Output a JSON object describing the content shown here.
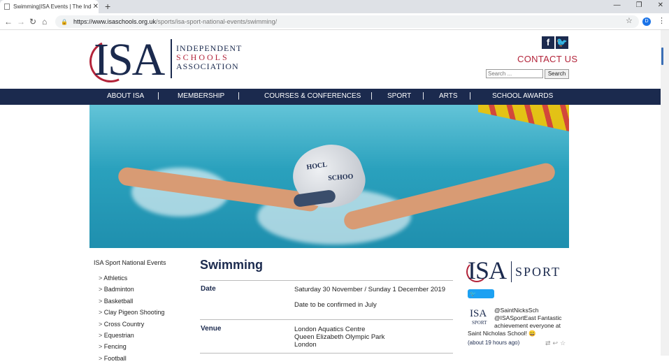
{
  "browser": {
    "tab_title": "Swimming|ISA Events | The Indep",
    "new_tab": "+",
    "url_host": "https://www.isaschools.org.uk",
    "url_path": "/sports/isa-sport-national-events/swimming/",
    "profile_initial": "D"
  },
  "header": {
    "logo_letters": "ISA",
    "logo_line1": "INDEPENDENT",
    "logo_line2": "SCHOOLS",
    "logo_line3": "ASSOCIATION",
    "facebook_glyph": "f",
    "twitter_glyph": "t",
    "contact": "CONTACT US",
    "search_placeholder": "Search ...",
    "search_button": "Search"
  },
  "nav": {
    "items": [
      "ABOUT ISA",
      "MEMBERSHIP",
      "COURSES & CONFERENCES",
      "SPORT",
      "ARTS",
      "SCHOOL AWARDS"
    ],
    "separator": "|"
  },
  "hero": {
    "cap_line1": "HOCL",
    "cap_line2": "SCHOO"
  },
  "sidebar": {
    "title": "ISA Sport National Events",
    "items": [
      "Athletics",
      "Badminton",
      "Basketball",
      "Clay Pigeon Shooting",
      "Cross Country",
      "Equestrian",
      "Fencing",
      "Football"
    ]
  },
  "main": {
    "title": "Swimming",
    "date_label": "Date",
    "date_value": "Saturday 30 November / Sunday 1 December 2019",
    "date_note": "Date to be confirmed in July",
    "venue_label": "Venue",
    "venue_line1": "London Aquatics Centre",
    "venue_line2": "Queen Elizabeth Olympic Park",
    "venue_line3": "London"
  },
  "right": {
    "sport_logo_isa": "ISA",
    "sport_logo_text": "SPORT",
    "follow_button": "Follow",
    "tweet_avatar_isa": "ISA",
    "tweet_avatar_sport": "SPORT",
    "tweet_line1": "@SaintNicksSch",
    "tweet_line2": "@ISASportEast Fantastic",
    "tweet_line3": "achievement everyone at",
    "tweet_line4": "Saint Nicholas School! 😀",
    "tweet_time": "(about 19 hours ago)"
  }
}
